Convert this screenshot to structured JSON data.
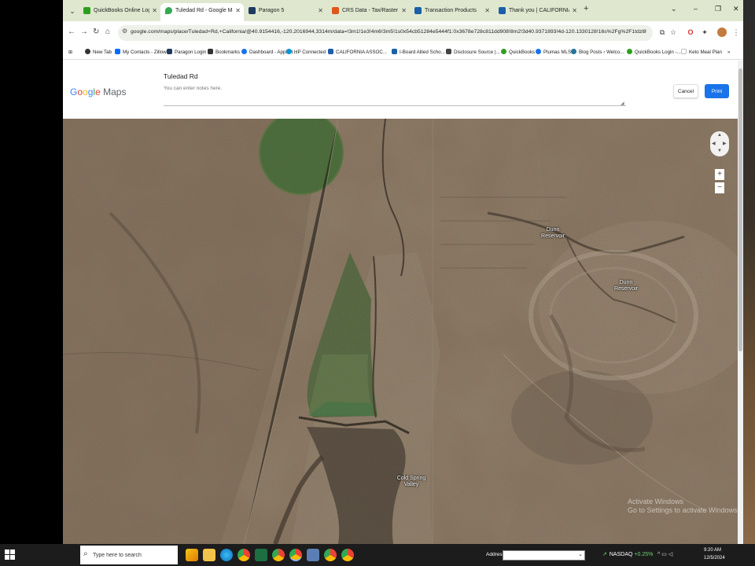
{
  "tabs": [
    {
      "title": "QuickBooks Online Login: Sign",
      "favicon_color": "#2ca01c"
    },
    {
      "title": "Tuledad Rd - Google Maps",
      "favicon_color": "#34a853",
      "active": true
    },
    {
      "title": "Paragon 5",
      "favicon_color": "#1e3a5f"
    },
    {
      "title": "CRS Data - Tax/Raster Map",
      "favicon_color": "#e0561b"
    },
    {
      "title": "Transaction Products",
      "favicon_color": "#1a5fa8"
    },
    {
      "title": "Thank you | CALIFORNIA ASSO",
      "favicon_color": "#1a5fa8"
    }
  ],
  "new_tab_symbol": "+",
  "window_controls": [
    "⌄",
    "–",
    "❐",
    "✕"
  ],
  "url": "google.com/maps/place/Tuledad+Rd,+California/@40.9154416,-120.2016944,3314m/data=!3m1!1e3!4m6!3m5!1s0x54cb51284e5444f1:0x3678e728c811dd908!8m2!3d40.9371893!4d-120.1330128!16s%2Fg%2F1tdzl8wb?entry=ttu&g_ep=E...",
  "bookmarks": [
    {
      "label": "New Tab",
      "color": "#333"
    },
    {
      "label": "My Contacts - Zillow",
      "color": "#006aff"
    },
    {
      "label": "Paragon Login",
      "color": "#1e3a5f"
    },
    {
      "label": "Bookmarks",
      "color": "#333"
    },
    {
      "label": "Dashboard - AppFol...",
      "color": "#1a73e8"
    },
    {
      "label": "HP Connected",
      "color": "#0096d6"
    },
    {
      "label": "CALIFORNIA ASSOC...",
      "color": "#1a5fa8"
    },
    {
      "label": "I-Board Allied Scho...",
      "color": "#1a5fa8"
    },
    {
      "label": "Disclosure Source |...",
      "color": "#444"
    },
    {
      "label": "QuickBooks",
      "color": "#2ca01c"
    },
    {
      "label": "Plumas MLS",
      "color": "#1a73e8"
    },
    {
      "label": "Blog Posts ‹ Welco...",
      "color": "#21759b"
    },
    {
      "label": "QuickBooks Login -...",
      "color": "#2ca01c"
    },
    {
      "label": "Keto Meal Plan",
      "color": "#bbb"
    }
  ],
  "print_header": {
    "logo_text": "Google Maps",
    "place_name": "Tuledad Rd",
    "notes_placeholder": "You can enter notes here.",
    "cancel_label": "Cancel",
    "print_label": "Print"
  },
  "map": {
    "labels": {
      "dunn_reservoir_small": "Dunn\nReservoir",
      "dunn_reservoir": "Dunn\nReservoir",
      "cold_spring_valley": "Cold Spring\nValley"
    },
    "zoom_in": "+",
    "zoom_out": "−",
    "watermark": "Activate Windows\nGo to Settings to activate Windows."
  },
  "taskbar": {
    "search_placeholder": "Type here to search",
    "address_label": "Address",
    "stock_name": "NASDAQ",
    "stock_change": "+0.25%",
    "time": "9:20 AM",
    "date": "12/5/2024"
  },
  "icons": {
    "back": "←",
    "forward": "→",
    "reload": "↻",
    "home": "⌂",
    "site_info": "⚙",
    "search": "⌕",
    "star": "☆",
    "lock": "🔒"
  }
}
